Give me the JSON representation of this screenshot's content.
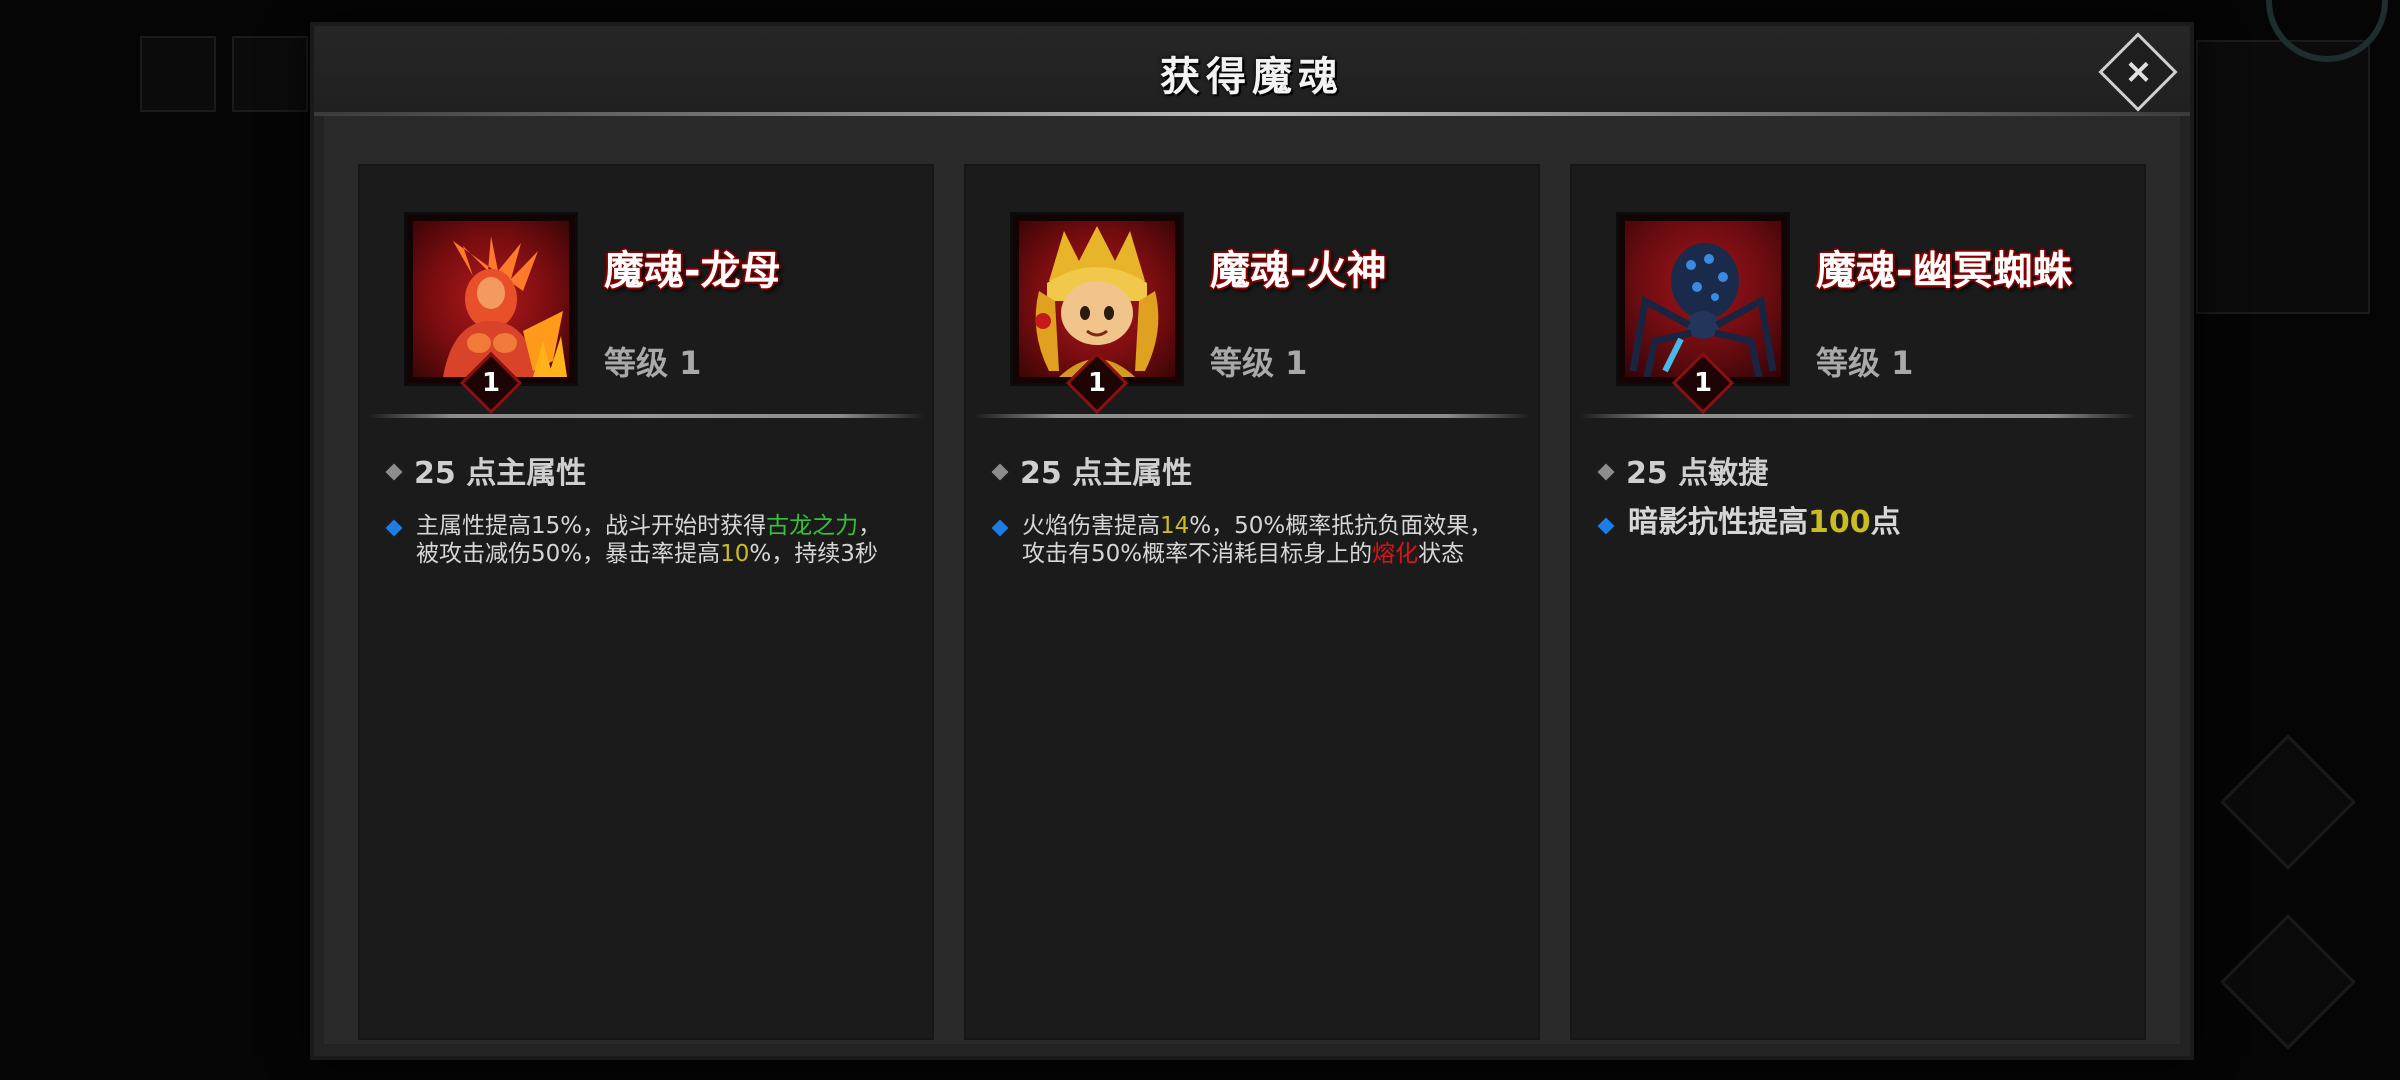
{
  "modal": {
    "title": "获得魔魂",
    "close_icon": "close-icon"
  },
  "colors": {
    "highlight_green": "#35c23a",
    "highlight_yellow": "#c9bd22",
    "highlight_red": "#d5161a",
    "bullet_blue": "#1d7de6",
    "name_outline": "#8a0000"
  },
  "cards": [
    {
      "name": "魔魂-龙母",
      "level": "等级 1",
      "badge": "1",
      "icon": "dragon-mother-portrait",
      "stat": "25 点主属性",
      "desc": {
        "l1_a": "主属性提高15%，战斗开始时获得",
        "l1_hl": "古龙之力",
        "l1_b": "，",
        "l2_a": "被攻击减伤50%，暴击率提高",
        "l2_hl": "10",
        "l2_b": "%，持续3秒"
      }
    },
    {
      "name": "魔魂-火神",
      "level": "等级 1",
      "badge": "1",
      "icon": "fire-god-portrait",
      "stat": "25 点主属性",
      "desc": {
        "l1_a": "火焰伤害提高",
        "l1_hl": "14",
        "l1_b": "%，50%概率抵抗负面效果，",
        "l2_a": "攻击有50%概率不消耗目标身上的",
        "l2_hl": "熔化",
        "l2_b": "状态"
      }
    },
    {
      "name": "魔魂-幽冥蜘蛛",
      "level": "等级 1",
      "badge": "1",
      "icon": "nether-spider-portrait",
      "stat": "25 点敏捷",
      "desc": {
        "a": "暗影抗性提高",
        "hl": "100",
        "b": "点"
      }
    }
  ]
}
